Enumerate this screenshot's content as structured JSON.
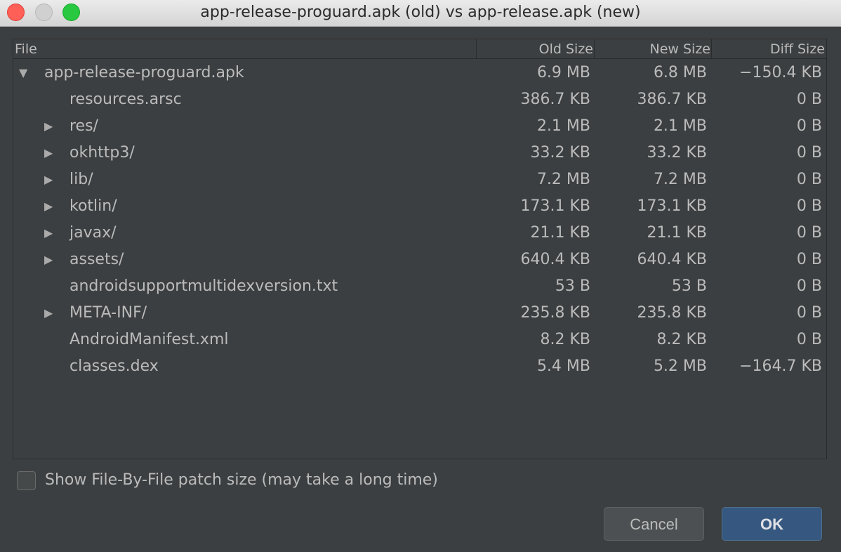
{
  "window": {
    "title": "app-release-proguard.apk (old) vs app-release.apk (new)"
  },
  "table": {
    "headers": {
      "file": "File",
      "old_size": "Old Size",
      "new_size": "New Size",
      "diff_size": "Diff Size"
    },
    "rows": [
      {
        "toggle": "▼",
        "name": "app-release-proguard.apk",
        "old": "6.9 MB",
        "new": "6.8 MB",
        "diff": "−150.4 KB"
      },
      {
        "toggle": "",
        "name": "resources.arsc",
        "old": "386.7 KB",
        "new": "386.7 KB",
        "diff": "0 B"
      },
      {
        "toggle": "▶",
        "name": "res/",
        "old": "2.1 MB",
        "new": "2.1 MB",
        "diff": "0 B"
      },
      {
        "toggle": "▶",
        "name": "okhttp3/",
        "old": "33.2 KB",
        "new": "33.2 KB",
        "diff": "0 B"
      },
      {
        "toggle": "▶",
        "name": "lib/",
        "old": "7.2 MB",
        "new": "7.2 MB",
        "diff": "0 B"
      },
      {
        "toggle": "▶",
        "name": "kotlin/",
        "old": "173.1 KB",
        "new": "173.1 KB",
        "diff": "0 B"
      },
      {
        "toggle": "▶",
        "name": "javax/",
        "old": "21.1 KB",
        "new": "21.1 KB",
        "diff": "0 B"
      },
      {
        "toggle": "▶",
        "name": "assets/",
        "old": "640.4 KB",
        "new": "640.4 KB",
        "diff": "0 B"
      },
      {
        "toggle": "",
        "name": "androidsupportmultidexversion.txt",
        "old": "53 B",
        "new": "53 B",
        "diff": "0 B"
      },
      {
        "toggle": "▶",
        "name": "META-INF/",
        "old": "235.8 KB",
        "new": "235.8 KB",
        "diff": "0 B"
      },
      {
        "toggle": "",
        "name": "AndroidManifest.xml",
        "old": "8.2 KB",
        "new": "8.2 KB",
        "diff": "0 B"
      },
      {
        "toggle": "",
        "name": "classes.dex",
        "old": "5.4 MB",
        "new": "5.2 MB",
        "diff": "−164.7 KB"
      }
    ]
  },
  "options": {
    "patch_size_label": "Show File-By-File patch size (may take a long time)",
    "patch_size_checked": false
  },
  "buttons": {
    "cancel": "Cancel",
    "ok": "OK"
  }
}
